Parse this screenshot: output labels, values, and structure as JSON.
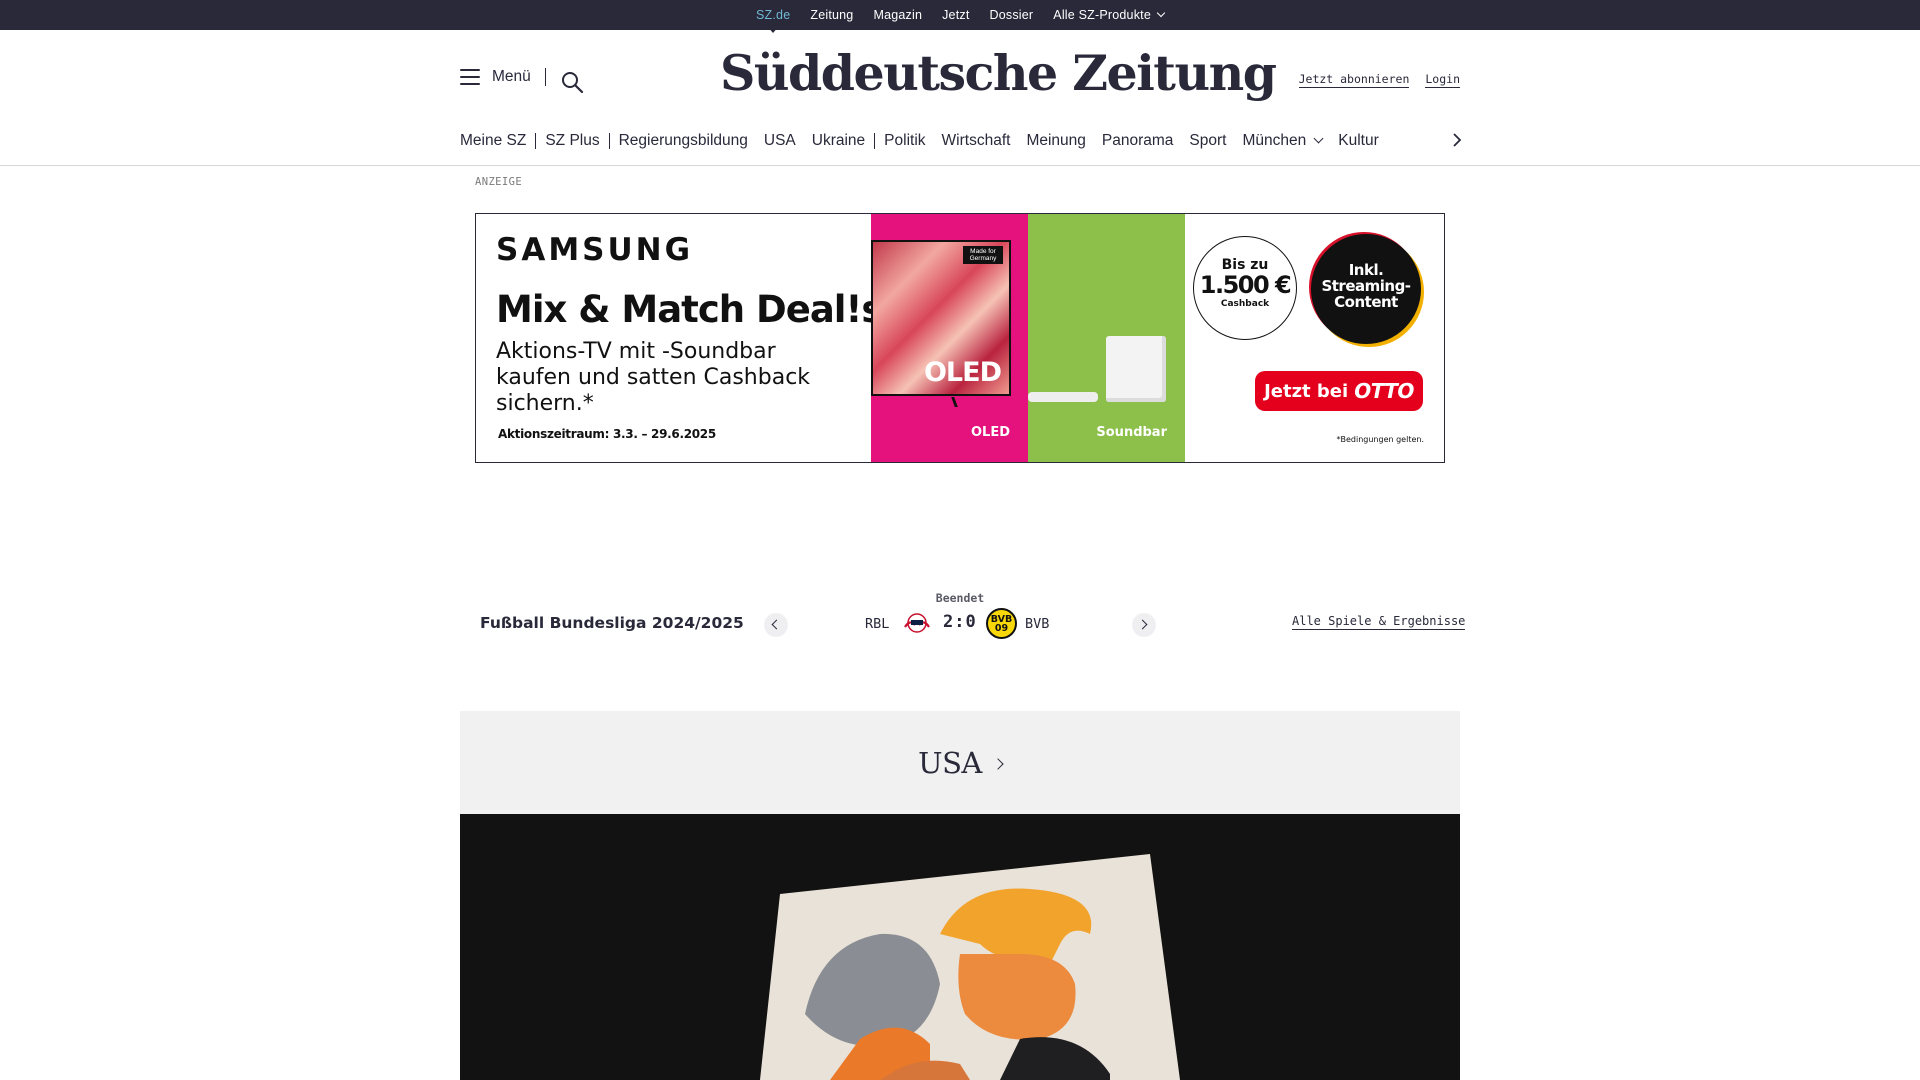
{
  "topbar": {
    "links": [
      "SZ.de",
      "Zeitung",
      "Magazin",
      "Jetzt",
      "Dossier",
      "Alle SZ-Produkte"
    ]
  },
  "header": {
    "menu_label": "Menü",
    "logo": "Süddeutsche Zeitung",
    "subscribe": "Jetzt abonnieren",
    "login": "Login"
  },
  "nav": {
    "items": [
      "Meine SZ",
      "SZ Plus",
      "Regierungsbildung",
      "USA",
      "Ukraine",
      "Politik",
      "Wirtschaft",
      "Meinung",
      "Panorama",
      "Sport",
      "München",
      "Kultur"
    ]
  },
  "ad": {
    "label": "ANZEIGE",
    "brand": "SAMSUNG",
    "headline": "Mix & Match Deal!s",
    "subline": "Aktions-TV mit -Soundbar kaufen und satten Cashback sichern.*",
    "period": "Aktionszeitraum: 3.3. – 29.6.2025",
    "tv_badge": "Made for Germany",
    "tv_text": "OLED",
    "oled_caption": "OLED",
    "soundbar_caption": "Soundbar",
    "cashback_top": "Bis zu",
    "cashback_amount": "1.500 €",
    "cashback_bottom": "Cashback",
    "streaming": "Inkl. Streaming-Content",
    "cta_text": "Jetzt bei",
    "cta_brand": "OTTO",
    "fineprint": "*Bedingungen gelten.",
    "colors": {
      "pink": "#e5127e",
      "green": "#8cc04b",
      "red": "#e4001c"
    }
  },
  "scoreboard": {
    "league": "Fußball Bundesliga 2024/2025",
    "status": "Beendet",
    "home": "RBL",
    "score": "2:0",
    "away": "BVB",
    "all_link": "Alle Spiele & Ergebnisse"
  },
  "section": {
    "title": "USA"
  }
}
